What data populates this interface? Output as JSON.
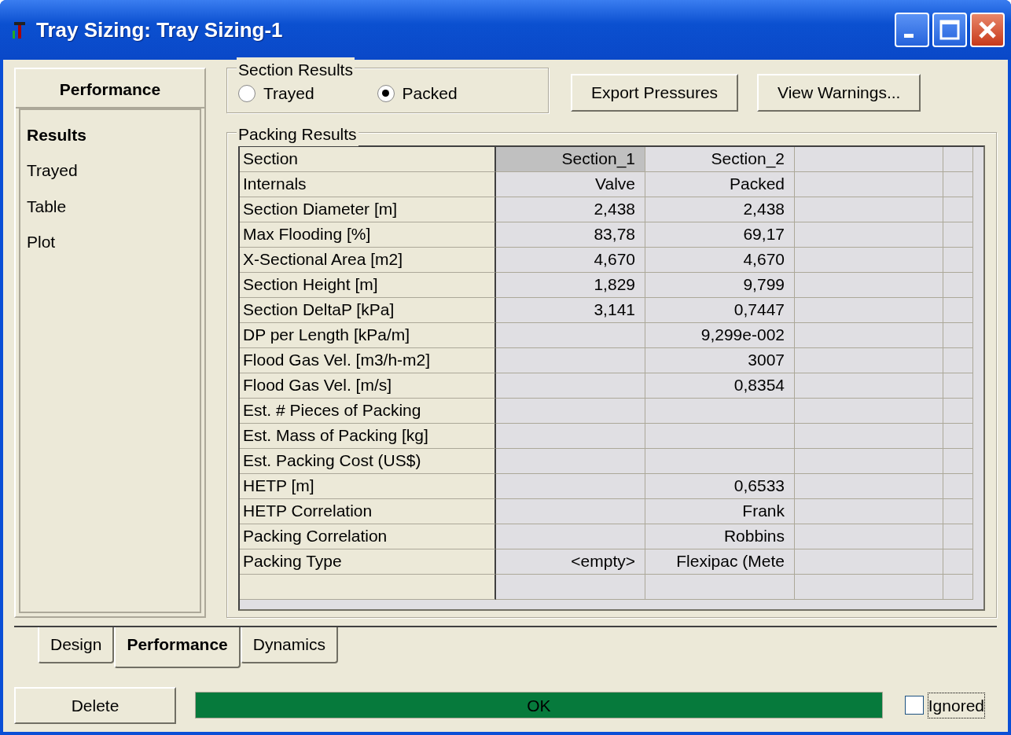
{
  "window": {
    "title": "Tray Sizing: Tray Sizing-1"
  },
  "sidebar": {
    "title": "Performance",
    "items": [
      {
        "label": "Results",
        "selected": true
      },
      {
        "label": "Trayed",
        "selected": false
      },
      {
        "label": "Table",
        "selected": false
      },
      {
        "label": "Plot",
        "selected": false
      }
    ]
  },
  "section_results": {
    "title": "Section Results",
    "options": [
      {
        "label": "Trayed",
        "selected": false
      },
      {
        "label": "Packed",
        "selected": true
      }
    ]
  },
  "buttons": [
    "Export Pressures",
    "View Warnings..."
  ],
  "packing_results": {
    "title": "Packing Results",
    "columns": [
      "Section",
      "Section_1",
      "Section_2"
    ],
    "rows": [
      [
        "Internals",
        "Valve",
        "Packed"
      ],
      [
        "Section Diameter [m]",
        "2,438",
        "2,438"
      ],
      [
        "Max Flooding [%]",
        "83,78",
        "69,17"
      ],
      [
        "X-Sectional Area [m2]",
        "4,670",
        "4,670"
      ],
      [
        "Section Height [m]",
        "1,829",
        "9,799"
      ],
      [
        "Section DeltaP [kPa]",
        "3,141",
        "0,7447"
      ],
      [
        "DP per Length [kPa/m]",
        "",
        "9,299e-002"
      ],
      [
        "Flood Gas Vel. [m3/h-m2]",
        "",
        "3007"
      ],
      [
        "Flood Gas Vel. [m/s]",
        "",
        "0,8354"
      ],
      [
        "Est. # Pieces of Packing",
        "",
        ""
      ],
      [
        "Est. Mass of Packing [kg]",
        "",
        ""
      ],
      [
        "Est. Packing Cost (US$)",
        "",
        ""
      ],
      [
        "HETP [m]",
        "",
        "0,6533"
      ],
      [
        "HETP Correlation",
        "",
        "Frank"
      ],
      [
        "Packing Correlation",
        "",
        "Robbins"
      ],
      [
        "Packing Type",
        "<empty>",
        "Flexipac (Mete"
      ]
    ]
  },
  "tabs": [
    {
      "label": "Design",
      "selected": false
    },
    {
      "label": "Performance",
      "selected": true
    },
    {
      "label": "Dynamics",
      "selected": false
    }
  ],
  "delete_button": "Delete",
  "status": {
    "text": "OK",
    "color": "#067a3c"
  },
  "ignored": {
    "label": "Ignored",
    "checked": false
  }
}
